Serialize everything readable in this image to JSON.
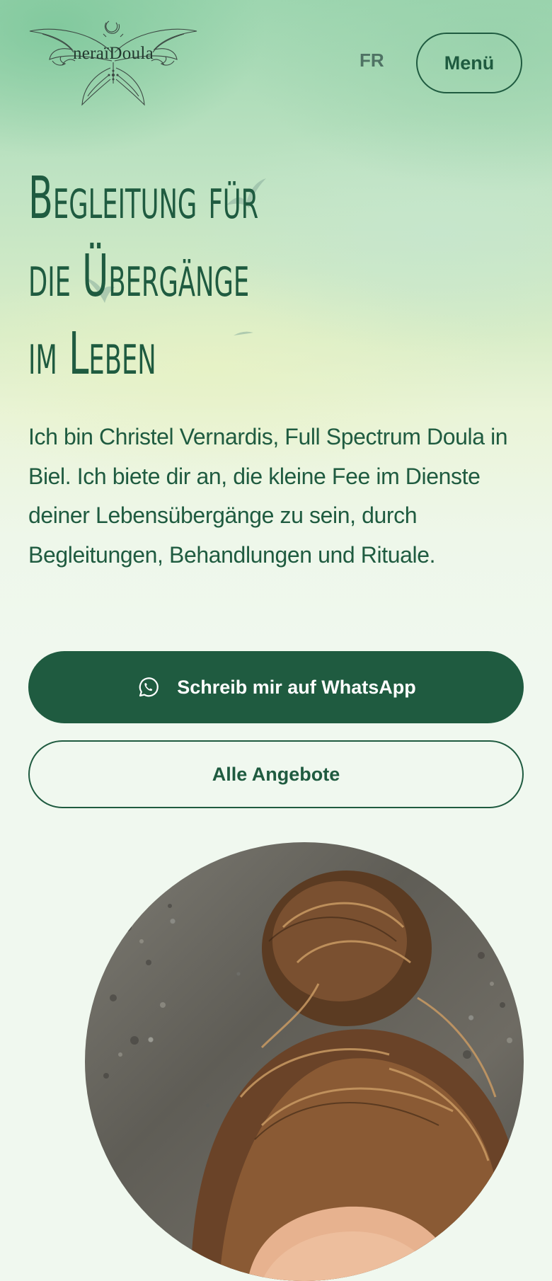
{
  "brand": {
    "name": "neraïDoula"
  },
  "nav": {
    "language_label": "FR",
    "menu_label": "Menü"
  },
  "hero": {
    "title_lines": [
      "Begleitung für",
      "die Übergänge",
      "im Leben"
    ],
    "intro": "Ich bin Christel Vernardis, Full Spectrum Doula in Biel. Ich biete dir an, die kleine Fee im Dienste deiner Lebensübergänge zu sein, durch Begleitungen, Behandlungen und Rituale."
  },
  "actions": {
    "whatsapp_label": "Schreib mir auf WhatsApp",
    "whatsapp_icon": "whatsapp-icon",
    "offers_label": "Alle Angebote"
  },
  "colors": {
    "primary": "#1f5b40",
    "background": "#f0f8ef",
    "button_text": "#ffffff"
  }
}
